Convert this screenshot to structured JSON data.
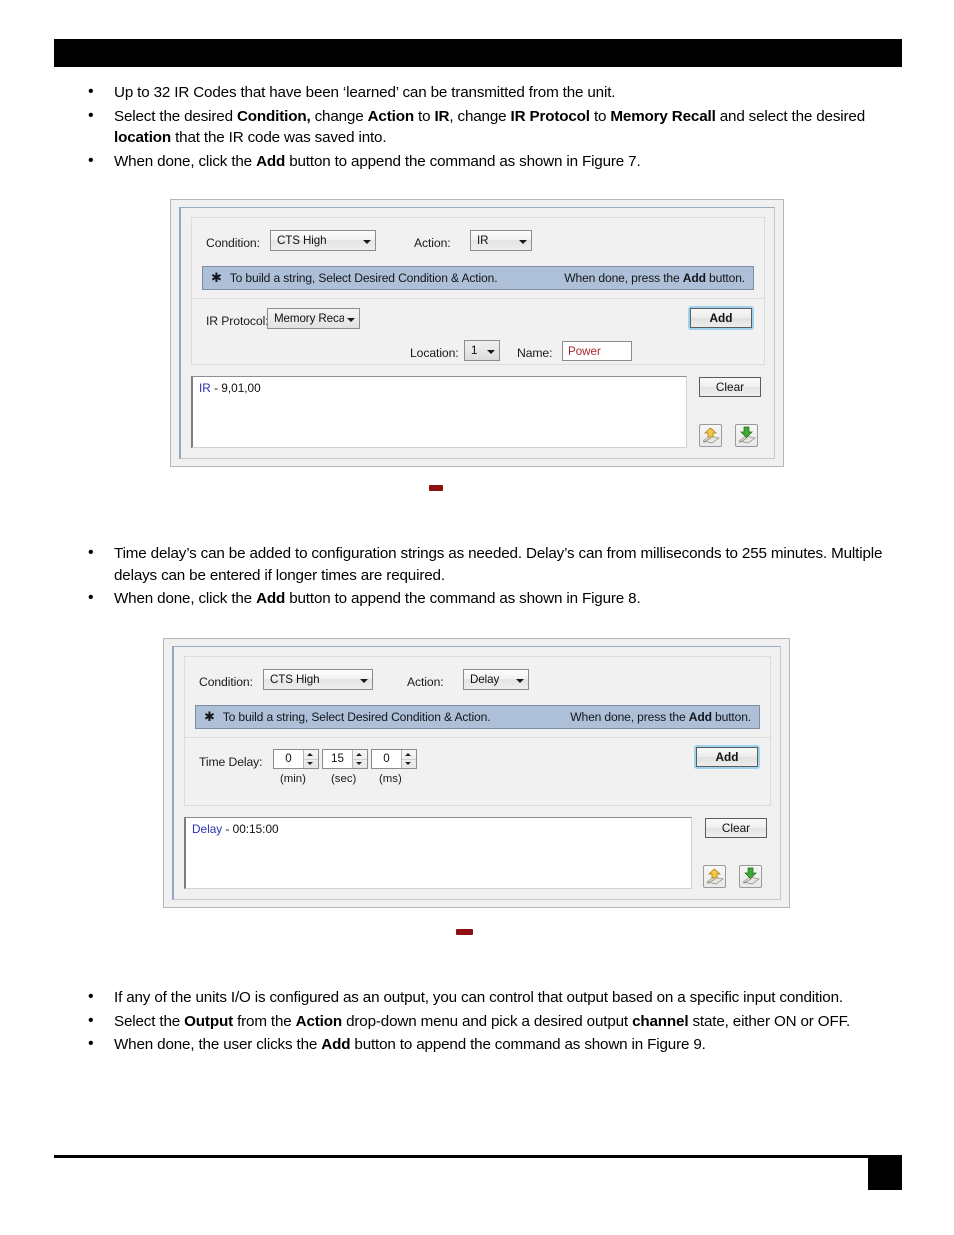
{
  "page": {
    "header_redacted": true,
    "footer_redacted": true,
    "accent_blue": "#2b2fb0",
    "info_bar_blue": "#aec0d8",
    "name_value_red": "#a6262b",
    "caption_dash_red": "#8d1013"
  },
  "block1": {
    "bullets": [
      {
        "parts": [
          {
            "t": "Up to 32 IR Codes that have been ‘learned’ can be transmitted from the unit.",
            "b": false
          }
        ]
      },
      {
        "parts": [
          {
            "t": "Select the desired ",
            "b": false
          },
          {
            "t": "Condition,",
            "b": true
          },
          {
            "t": " change ",
            "b": false
          },
          {
            "t": "Action",
            "b": true
          },
          {
            "t": " to ",
            "b": false
          },
          {
            "t": "IR",
            "b": true
          },
          {
            "t": ", change ",
            "b": false
          },
          {
            "t": "IR Protocol",
            "b": true
          },
          {
            "t": " to ",
            "b": false
          },
          {
            "t": "Memory Recall",
            "b": true
          },
          {
            "t": " and select the desired ",
            "b": false
          },
          {
            "t": "location",
            "b": true
          },
          {
            "t": " that the IR code was saved into.",
            "b": false
          }
        ]
      },
      {
        "parts": [
          {
            "t": "When done, click the ",
            "b": false
          },
          {
            "t": "Add",
            "b": true
          },
          {
            "t": " button to append the command as shown in Figure 7.",
            "b": false
          }
        ]
      }
    ]
  },
  "block2": {
    "bullets": [
      {
        "parts": [
          {
            "t": "Time delay’s can be added to configuration strings as needed.  Delay’s can from milliseconds to 255 minutes. Multiple delays can be entered if longer times are required.",
            "b": false
          }
        ]
      },
      {
        "parts": [
          {
            "t": "When done, click the ",
            "b": false
          },
          {
            "t": "Add",
            "b": true
          },
          {
            "t": " button to append the command as shown in Figure 8.",
            "b": false
          }
        ]
      }
    ]
  },
  "block3": {
    "bullets": [
      {
        "parts": [
          {
            "t": "If any of the units I/O is configured as an output, you can control that output based on a specific input condition.",
            "b": false
          }
        ]
      },
      {
        "parts": [
          {
            "t": "Select the ",
            "b": false
          },
          {
            "t": "Output",
            "b": true
          },
          {
            "t": " from the ",
            "b": false
          },
          {
            "t": "Action",
            "b": true
          },
          {
            "t": " drop-down menu and pick a desired output ",
            "b": false
          },
          {
            "t": "channel",
            "b": true
          },
          {
            "t": " state, either ON or OFF.",
            "b": false
          }
        ]
      },
      {
        "parts": [
          {
            "t": "When done, the user clicks the ",
            "b": false
          },
          {
            "t": "Add",
            "b": true
          },
          {
            "t": " button to append the command as shown in Figure 9.",
            "b": false
          }
        ]
      }
    ]
  },
  "figure1": {
    "condition_label": "Condition:",
    "condition_value": "CTS High",
    "action_label": "Action:",
    "action_value": "IR",
    "info_asterisk": "✱",
    "info_left": "To build a string, Select Desired Condition & Action.",
    "info_right_pre": "When done, press the ",
    "info_right_bold": "Add",
    "info_right_post": " button.",
    "ir_protocol_label": "IR Protocol:",
    "ir_protocol_value": "Memory Recall",
    "location_label": "Location:",
    "location_value": "1",
    "name_label": "Name:",
    "name_value": "Power",
    "add_label": "Add",
    "clear_label": "Clear",
    "output_tag": "IR",
    "output_rest": " - 9,01,00",
    "open_icon": "open-file-icon",
    "save_icon": "save-file-icon"
  },
  "figure2": {
    "condition_label": "Condition:",
    "condition_value": "CTS High",
    "action_label": "Action:",
    "action_value": "Delay",
    "info_asterisk": "✱",
    "info_left": "To build a string, Select Desired Condition & Action.",
    "info_right_pre": "When done, press the ",
    "info_right_bold": "Add",
    "info_right_post": " button.",
    "time_delay_label": "Time Delay:",
    "delay_min": "0",
    "delay_sec": "15",
    "delay_ms": "0",
    "unit_min": "(min)",
    "unit_sec": "(sec)",
    "unit_ms": "(ms)",
    "add_label": "Add",
    "clear_label": "Clear",
    "output_tag": "Delay",
    "output_rest": " - 00:15:00",
    "open_icon": "open-file-icon",
    "save_icon": "save-file-icon"
  }
}
